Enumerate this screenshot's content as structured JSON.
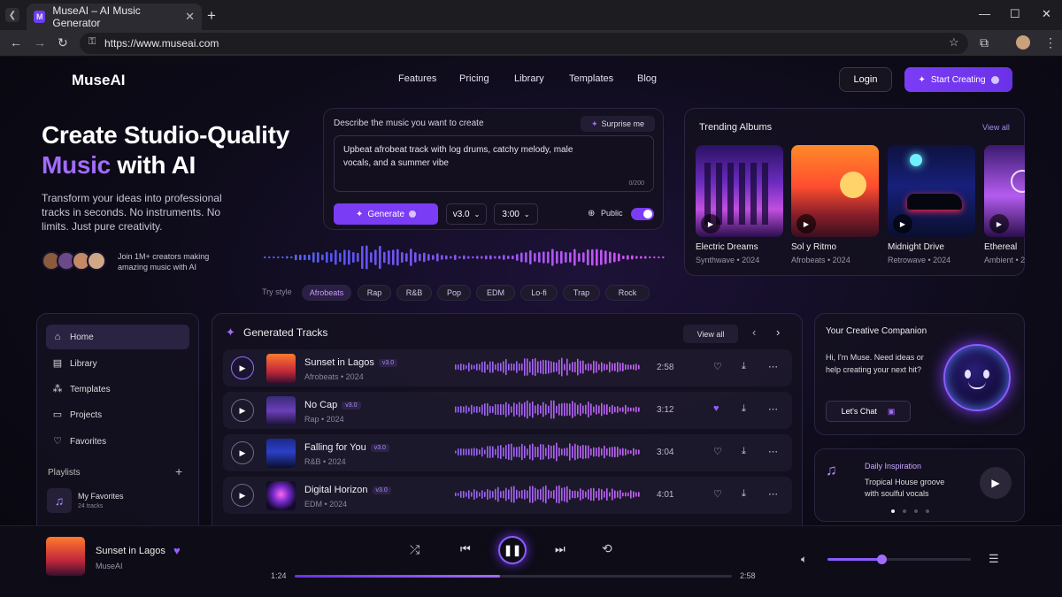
{
  "browser": {
    "tab_title": "MuseAI – AI Music Generator",
    "favicon_letter": "M",
    "url": "https://www.museai.com"
  },
  "header": {
    "logo": "MuseAI",
    "nav": [
      "Features",
      "Pricing",
      "Library",
      "Templates",
      "Blog"
    ],
    "login": "Login",
    "start": "Start Creating"
  },
  "hero": {
    "line1": "Create Studio-Quality",
    "line2_accent": "Music",
    "line2_rest": " with AI",
    "subtitle": "Transform your ideas into professional tracks in seconds. No instruments. No limits. Just pure creativity.",
    "join": "Join 1M+ creators making amazing music with AI"
  },
  "prompt": {
    "label": "Describe the music you want to create",
    "surprise": "Surprise me",
    "text": "Upbeat afrobeat track with log drums, catchy melody, male vocals, and a summer vibe",
    "counter": "0/200",
    "generate": "Generate",
    "version": "v3.0",
    "duration": "3:00",
    "public_label": "Public",
    "public_on": true
  },
  "styles": {
    "label": "Try style",
    "chips": [
      "Afrobeats",
      "Rap",
      "R&B",
      "Pop",
      "EDM",
      "Lo-fi",
      "Trap",
      "Rock"
    ],
    "selected": "Afrobeats"
  },
  "trending": {
    "title": "Trending Albums",
    "view_all": "View all",
    "albums": [
      {
        "title": "Electric Dreams",
        "meta": "Synthwave • 2024"
      },
      {
        "title": "Sol y Ritmo",
        "meta": "Afrobeats • 2024"
      },
      {
        "title": "Midnight Drive",
        "meta": "Retrowave • 2024"
      },
      {
        "title": "Ethereal",
        "meta": "Ambient • 2"
      }
    ]
  },
  "sidebar": {
    "items": [
      "Home",
      "Library",
      "Templates",
      "Projects",
      "Favorites"
    ],
    "active": "Home",
    "playlists_label": "Playlists",
    "playlist": {
      "name": "My Favorites",
      "count": "24 tracks"
    }
  },
  "tracks": {
    "title": "Generated Tracks",
    "view_all": "View all",
    "items": [
      {
        "title": "Sunset in Lagos",
        "version": "v3.0",
        "meta": "Afrobeats • 2024",
        "duration": "2:58",
        "liked": false
      },
      {
        "title": "No Cap",
        "version": "v3.0",
        "meta": "Rap • 2024",
        "duration": "3:12",
        "liked": true
      },
      {
        "title": "Falling for You",
        "version": "v3.0",
        "meta": "R&B • 2024",
        "duration": "3:04",
        "liked": false
      },
      {
        "title": "Digital Horizon",
        "version": "v3.0",
        "meta": "EDM • 2024",
        "duration": "4:01",
        "liked": false
      }
    ]
  },
  "companion": {
    "title": "Your Creative Companion",
    "text": "Hi, I'm Muse. Need ideas or help creating your next hit?",
    "button": "Let's Chat"
  },
  "inspiration": {
    "label": "Daily Inspiration",
    "text": "Tropical House groove with soulful vocals",
    "dots_total": 4,
    "dots_active": 1
  },
  "player": {
    "title": "Sunset in Lagos",
    "artist": "MuseAI",
    "elapsed": "1:24",
    "total": "2:58",
    "progress": 0.47,
    "volume": 0.38
  },
  "colors": {
    "accent": "#7b3cf5",
    "accent_light": "#a36bff"
  }
}
